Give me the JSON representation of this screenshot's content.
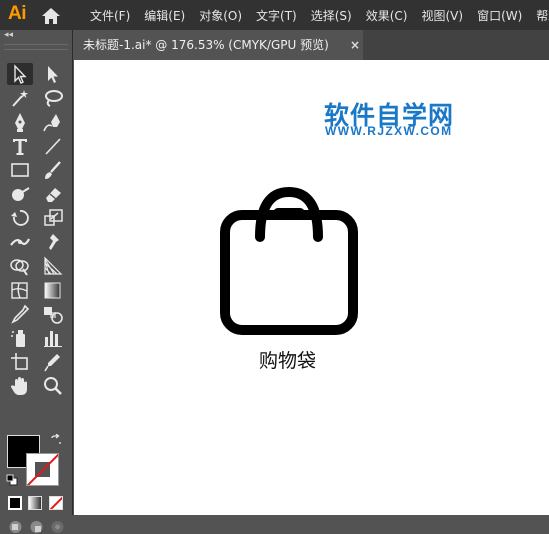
{
  "app": {
    "logo": "Ai"
  },
  "menu": [
    "文件(F)",
    "编辑(E)",
    "对象(O)",
    "文字(T)",
    "选择(S)",
    "效果(C)",
    "视图(V)",
    "窗口(W)",
    "帮助"
  ],
  "tab": {
    "title": "未标题-1.ai* @ 176.53% (CMYK/GPU 预览)",
    "close": "×"
  },
  "toolbar": {
    "collapse": "◂◂",
    "tools": [
      "selection-tool",
      "direct-selection-tool",
      "magic-wand-tool",
      "lasso-tool",
      "pen-tool",
      "curvature-tool",
      "type-tool",
      "line-segment-tool",
      "rectangle-tool",
      "paintbrush-tool",
      "shaper-tool",
      "eraser-tool",
      "rotate-tool",
      "scale-tool",
      "width-tool",
      "puppet-warp-tool",
      "shape-builder-tool",
      "perspective-grid-tool",
      "mesh-tool",
      "gradient-tool",
      "eyedropper-tool",
      "blend-tool",
      "symbol-sprayer-tool",
      "column-graph-tool",
      "artboard-tool",
      "slice-tool",
      "hand-tool",
      "zoom-tool"
    ],
    "fill_color": "#000000",
    "stroke_color": "none"
  },
  "canvas": {
    "watermark_title": "软件自学网",
    "watermark_url": "WWW.RJZXW.COM",
    "watermark_color": "#1a78c8",
    "icon": "shopping-bag-icon",
    "caption": "购物袋"
  }
}
